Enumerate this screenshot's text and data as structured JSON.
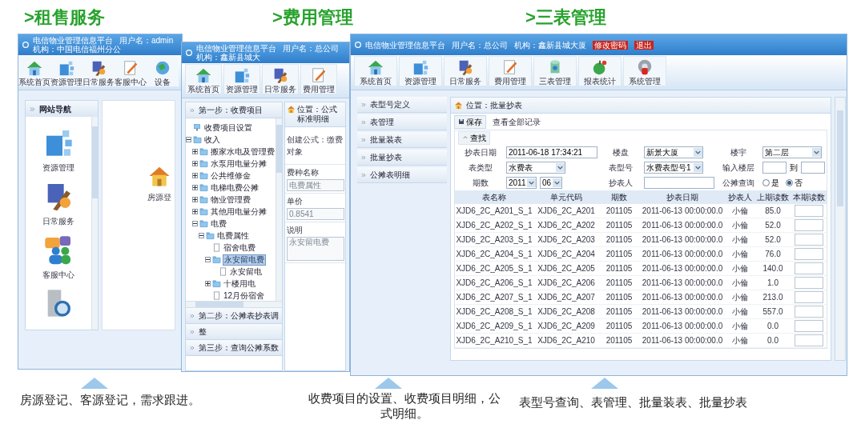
{
  "headings": [
    ">租售服务",
    ">费用管理",
    ">三表管理"
  ],
  "window_rental": {
    "title": {
      "app": "电信物业管理信息平台",
      "user": "用户名：admin",
      "org": "机构：中国电信福州分公"
    },
    "toolbar": [
      "系统首页",
      "资源管理",
      "日常服务",
      "客服中心",
      "设备"
    ],
    "nav": {
      "title": "网站导航",
      "items": [
        "资源管理",
        "日常服务",
        "客服中心"
      ]
    },
    "main_label": "房源登"
  },
  "window_fees": {
    "title": {
      "app": "电信物业管理信息平台",
      "user": "用户名：总公司",
      "org": "机构：鑫新县城大"
    },
    "toolbar": [
      "系统首页",
      "资源管理",
      "日常服务",
      "费用管理"
    ],
    "steps_top": [
      "第一步：收费项目"
    ],
    "tree": [
      {
        "label": "收费项目设置",
        "kind": "root",
        "selected": false
      },
      {
        "label": "收入",
        "kind": "folder",
        "expanded": true,
        "selected": false,
        "children": [
          {
            "label": "搬家水电及管理费",
            "kind": "folder",
            "expanded": false,
            "selected": false
          },
          {
            "label": "水泵用电量分摊",
            "kind": "folder",
            "expanded": false,
            "selected": false
          },
          {
            "label": "公共维修金",
            "kind": "folder",
            "expanded": false,
            "selected": false
          },
          {
            "label": "电梯电费公摊",
            "kind": "folder",
            "expanded": false,
            "selected": false
          },
          {
            "label": "物业管理费",
            "kind": "folder",
            "expanded": false,
            "selected": false
          },
          {
            "label": "其他用电量分摊",
            "kind": "folder",
            "expanded": false,
            "selected": false
          },
          {
            "label": "电费",
            "kind": "folder",
            "expanded": true,
            "selected": false,
            "children": [
              {
                "label": "电费属性",
                "kind": "folder",
                "expanded": true,
                "selected": false,
                "children": [
                  {
                    "label": "宿舍电费",
                    "kind": "file",
                    "selected": false
                  },
                  {
                    "label": "永安留电费",
                    "kind": "folder",
                    "expanded": true,
                    "selected": true,
                    "children": [
                      {
                        "label": "永安留电",
                        "kind": "file",
                        "selected": false
                      }
                    ]
                  },
                  {
                    "label": "十楼用电",
                    "kind": "folder",
                    "expanded": false,
                    "selected": false
                  },
                  {
                    "label": "12月份宿舍",
                    "kind": "file",
                    "selected": false
                  }
                ]
              }
            ]
          }
        ]
      }
    ],
    "steps_bottom": [
      "第二步：公摊表抄表调",
      "整",
      "第三步：查询公摊系数"
    ],
    "location": "位置：公式标准明细",
    "create_line": "创建公式：缴费对象",
    "form": [
      {
        "label": "费种名称",
        "value": "电费属性",
        "kind": "input"
      },
      {
        "label": "单价",
        "value": "0.8541",
        "kind": "input"
      },
      {
        "label": "说明",
        "value": "永安留电费",
        "kind": "textarea"
      }
    ]
  },
  "window_meters": {
    "title": {
      "app": "电信物业管理信息平台",
      "user": "用户名：总公司",
      "org": "机构：鑫新县城大厦"
    },
    "title_links": [
      "修改密码",
      "退出"
    ],
    "toolbar": [
      "系统首页",
      "资源管理",
      "日常服务",
      "费用管理",
      "三表管理",
      "报表统计",
      "系统管理"
    ],
    "sidebar": [
      "表型号定义",
      "表管理",
      "批量装表",
      "批量抄表",
      "公摊表明细"
    ],
    "location": "位置：批量抄表",
    "actions": [
      "保存",
      "查看全部记录"
    ],
    "search_label": "查找",
    "filters": [
      {
        "label": "抄表日期",
        "kind": "text",
        "value": "2011-06-18 17:34:21"
      },
      {
        "label": "楼盘",
        "kind": "select",
        "value": "新景大厦"
      },
      {
        "label": "楼宇",
        "kind": "select",
        "value": "第二层"
      },
      {
        "label": "表类型",
        "kind": "select",
        "value": "水费表"
      },
      {
        "label": "表型号",
        "kind": "select",
        "value": "水费表型号1"
      },
      {
        "label": "输入楼层",
        "kind": "range",
        "separator": "到"
      },
      {
        "label": "期数",
        "kind": "period",
        "year": "2011",
        "month": "06"
      },
      {
        "label": "抄表人",
        "kind": "text"
      },
      {
        "label": "公摊查询",
        "kind": "radio",
        "options": [
          {
            "label": "是",
            "selected": false
          },
          {
            "label": "否",
            "selected": true
          }
        ]
      }
    ],
    "table": {
      "columns": [
        "表名称",
        "单元代码",
        "期数",
        "抄表日期",
        "抄表人",
        "上期读数",
        "本期读数"
      ],
      "rows": [
        [
          "XJD6_2C_A201_S_1",
          "XJD6_2C_A201",
          "201105",
          "2011-06-13 00:00:00.0",
          "小倫",
          "85.0"
        ],
        [
          "XJD6_2C_A202_S_1",
          "XJD6_2C_A202",
          "201105",
          "2011-06-13 00:00:00.0",
          "小倫",
          "52.0"
        ],
        [
          "XJD6_2C_A203_S_1",
          "XJD6_2C_A203",
          "201105",
          "2011-06-13 00:00:00.0",
          "小倫",
          "52.0"
        ],
        [
          "XJD6_2C_A204_S_1",
          "XJD6_2C_A204",
          "201105",
          "2011-06-13 00:00:00.0",
          "小倫",
          "76.0"
        ],
        [
          "XJD6_2C_A205_S_1",
          "XJD6_2C_A205",
          "201105",
          "2011-06-13 00:00:00.0",
          "小倫",
          "140.0"
        ],
        [
          "XJD6_2C_A206_S_1",
          "XJD6_2C_A206",
          "201105",
          "2011-06-13 00:00:00.0",
          "小倫",
          "1.0"
        ],
        [
          "XJD6_2C_A207_S_1",
          "XJD6_2C_A207",
          "201105",
          "2011-06-13 00:00:00.0",
          "小倫",
          "213.0"
        ],
        [
          "XJD6_2C_A208_S_1",
          "XJD6_2C_A208",
          "201105",
          "2011-06-13 00:00:00.0",
          "小倫",
          "557.0"
        ],
        [
          "XJD6_2C_A209_S_1",
          "XJD6_2C_A209",
          "201105",
          "2011-06-13 00:00:00.0",
          "小倫",
          "0.0"
        ],
        [
          "XJD6_2C_A210_S_1",
          "XJD6_2C_A210",
          "201105",
          "2011-06-13 00:00:00.0",
          "小倫",
          "0.0"
        ]
      ]
    }
  },
  "captions": [
    "房源登记、客源登记，需求跟进。",
    "收费项目的设置、收费项目明细，公式明细。",
    "表型号查询、表管理、批量装表、批量抄表"
  ]
}
